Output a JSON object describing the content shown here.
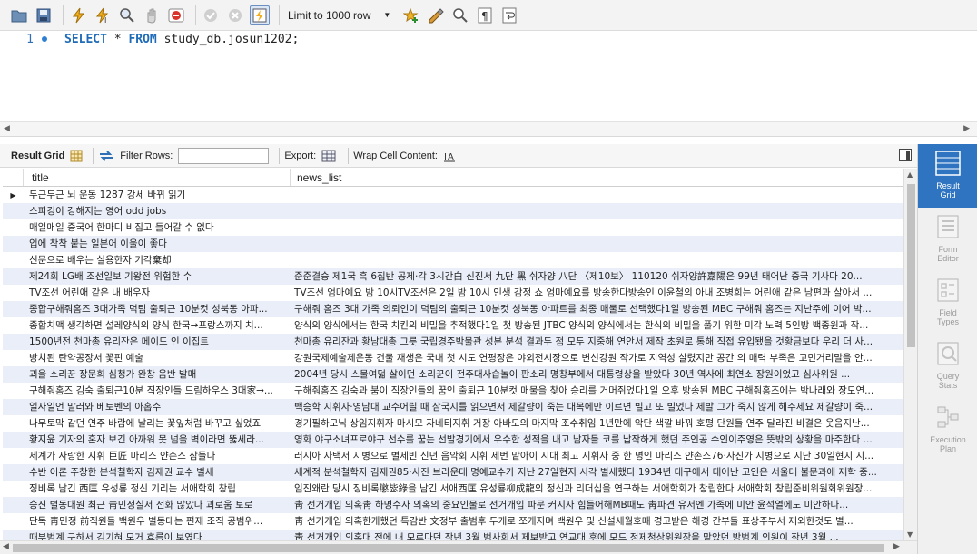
{
  "toolbar": {
    "limit_label": "Limit to 1000 row"
  },
  "editor": {
    "line_number": "1",
    "kw_select": "SELECT",
    "star": " * ",
    "kw_from": "FROM",
    "table": " study_db.josun1202;"
  },
  "result_toolbar": {
    "result_grid_label": "Result Grid",
    "filter_rows_label": "Filter Rows:",
    "filter_value": "",
    "export_label": "Export:",
    "wrap_label": "Wrap Cell Content:"
  },
  "grid": {
    "columns": [
      "title",
      "news_list"
    ],
    "rows": [
      {
        "title": "두근두근 뇌 운동 1287 강세 바뀌 읽기",
        "news": ""
      },
      {
        "title": "스피킹이 강해지는 영어 odd jobs",
        "news": ""
      },
      {
        "title": "매일매일 중국어 한마디 비집고 들어갈 수 없다",
        "news": ""
      },
      {
        "title": "입에 착착 붙는 일본어 이울이 좋다",
        "news": ""
      },
      {
        "title": "신문으로 배우는 실용한자 기각棄却",
        "news": ""
      },
      {
        "title": "제24회 LG배 조선일보 기왕전 위험한 수",
        "news": "준준결승 제1국 흑 6집반 공제·각 3시간白 신진서 九단 黑 쉬자양 八단 〈제10보〉 110120 쉬자양許嘉陽은 99년 태어난 중국 기사다 20..."
      },
      {
        "title": "TV조선 어린애 같은 내 배우자",
        "news": "TV조선 엄마예요 밤 10시TV조선은 2일 밤 10시 인생 감정 쇼 엄마예요를 방송한다방송인 이윤철의 아내 조병희는 어린애 같은 남편과 살아서 ..."
      },
      {
        "title": "종합구해줘홈즈 3대가족 덕팀 출퇴근 10분컷 성북동 아파...",
        "news": "구해줘 홈즈 3대 가족 의뢰인이 덕팀의 출퇴근 10분컷 성북동 아파트를 최종 매물로 선택했다1일 방송된 MBC 구해줘 홈즈는 지난주에 이어 박..."
      },
      {
        "title": "종합치맥 생각하면 설레양식의 양식 한국→프랑스까지 치...",
        "news": "양식의 양식에서는 한국 치킨의 비밀을 추적했다1일 첫 방송된 JTBC 양식의 양식에서는 한식의 비밀을 풀기 위한 미각 노력 5인방 백종원과 작..."
      },
      {
        "title": "1500년전 천마총 유리잔은 메이드 인 이집트",
        "news": "천마총 유리잔과 황남대총 그릇 국립경주박물관 성분 분석 결과두 점 모두 지중해 연안서 제작 초원로 통해 직접 유입됐을 것황금보다 우리 더 사..."
      },
      {
        "title": "방치된 탄약공장서 꽃핀 예술",
        "news": "강원국제예술제운동 건물 재생은 국내 첫 시도 연평장은 야외전시장으로 변신강원 작가로 지역성 살렸지만 공간 의 매력 부족은 고민거리말을 안..."
      },
      {
        "title": "괴을 소리꾼 장문희 심청가 완창 음반 발매",
        "news": "2004년 당시 스물여덟 살이던 소리꾼이 전주대사습놀이 판소리 명창부에서 대통령상을 받았다 30년 역사에 최연소 장원이었고 심사위원 ..."
      },
      {
        "title": "구해줘홈즈 김숙 출퇴근10분 직장인들 드림하우스 3대家→...",
        "news": "구해줘홈즈 김숙과 붐이 직장인들의 꿈인 출퇴근 10분컷 매물을 찾아 승리를 거머쥐었다1일 오후 방송된 MBC 구해줘홈즈에는 박나래와 장도연..."
      },
      {
        "title": "일사일언 말러와 베토벤의 아홉수",
        "news": "백승학 지휘자·영남대 교수어릴 때 삼국지를 읽으면서 제갈량이 죽는 대목에만 이르면 빌고 또 빌었다 제발 그가 죽지 않게 해주세요 제갈량이 죽..."
      },
      {
        "title": "나무토막 같던 연주 바람에 날리는 꽃잎처럼 바꾸고 싶었죠",
        "news": "경기필하모닉 상임지휘자 마시모 자네티지휘 거장 아바도의 마지막 조수취임 1년만에 악단 색깔 바꿔 호평 단원들 연주 달라진 비결은 웃음지난..."
      },
      {
        "title": "황지윤 기자의 혼자 보긴 아까워 못 넘을 벽이라면 뚫세라...",
        "news": "영화 야구소녀프로야구 선수를 꿈는 선발경기에서 우수한 성적을 내고 남자들 코를 납작하게 했던 주인공 수인이주영은 뜻밖의 상황을 마주한다 ..."
      },
      {
        "title": "세계가 사랑한 지휘 巨匠 마리스 얀손스 잠들다",
        "news": "러시아 자택서 지병으로 별세빈 신년 음악회 지휘 세번 맡아이 시대 최고 지휘자 중 한 명인 마리스 얀손스76·사진가 지병으로 지난 30일현지 시..."
      },
      {
        "title": "수반 이론 주창한 분석철학자 김재권 교수 별세",
        "news": "세계적 분석철학자 김재권85·사진 브라운대 명예교수가 지난 27일현지 시각 별세했다 1934년 대구에서 태어난 고인은 서울대 불문과에 재학 중..."
      },
      {
        "title": "징비록 남긴 西匡 유성룡 정신 기리는 서애학회 창립",
        "news": "임진왜란 당시 징비록懲毖錄을 남긴 서애西匡 유성룡柳成龍의 정신과 리더십을 연구하는 서애학회가 창립한다 서애학회 창립준비위원회위원장..."
      },
      {
        "title": "승진 별동대원 최근 靑민정실서 전화 많았다 괴로움 토로",
        "news": "靑 선거개입 의혹靑 하명수사 의혹의 중요인물로 선거개입 파문 커지자 힘들어해MB때도 靑파견 유서엔 가족에 미안 윤석열에도 미안하다..."
      },
      {
        "title": "단독 靑민정 前직원들 백원우 별동대는 편제 조직 공범위...",
        "news": "靑 선거개입 의혹한개했던 특감반 文정부 출범후 두개로 쪼개지며 백원우 및 신설세월호때 경고받은 해경 간부들 표상주부서 제외한것도 별..."
      },
      {
        "title": "때부범계 구하서 김기혀 모거 흐름이 보였다",
        "news": "靑 선거개입 의혹대 전에 내 모르다던 작년 3월 범사회서 제보받고 연교대 후에 모드 정제청상위원장을 맡았던 방범계 의원이 작년 3월 ..."
      }
    ]
  },
  "side_panel": {
    "items": [
      "Result\nGrid",
      "Form\nEditor",
      "Field\nTypes",
      "Query\nStats",
      "Execution\nPlan"
    ]
  }
}
